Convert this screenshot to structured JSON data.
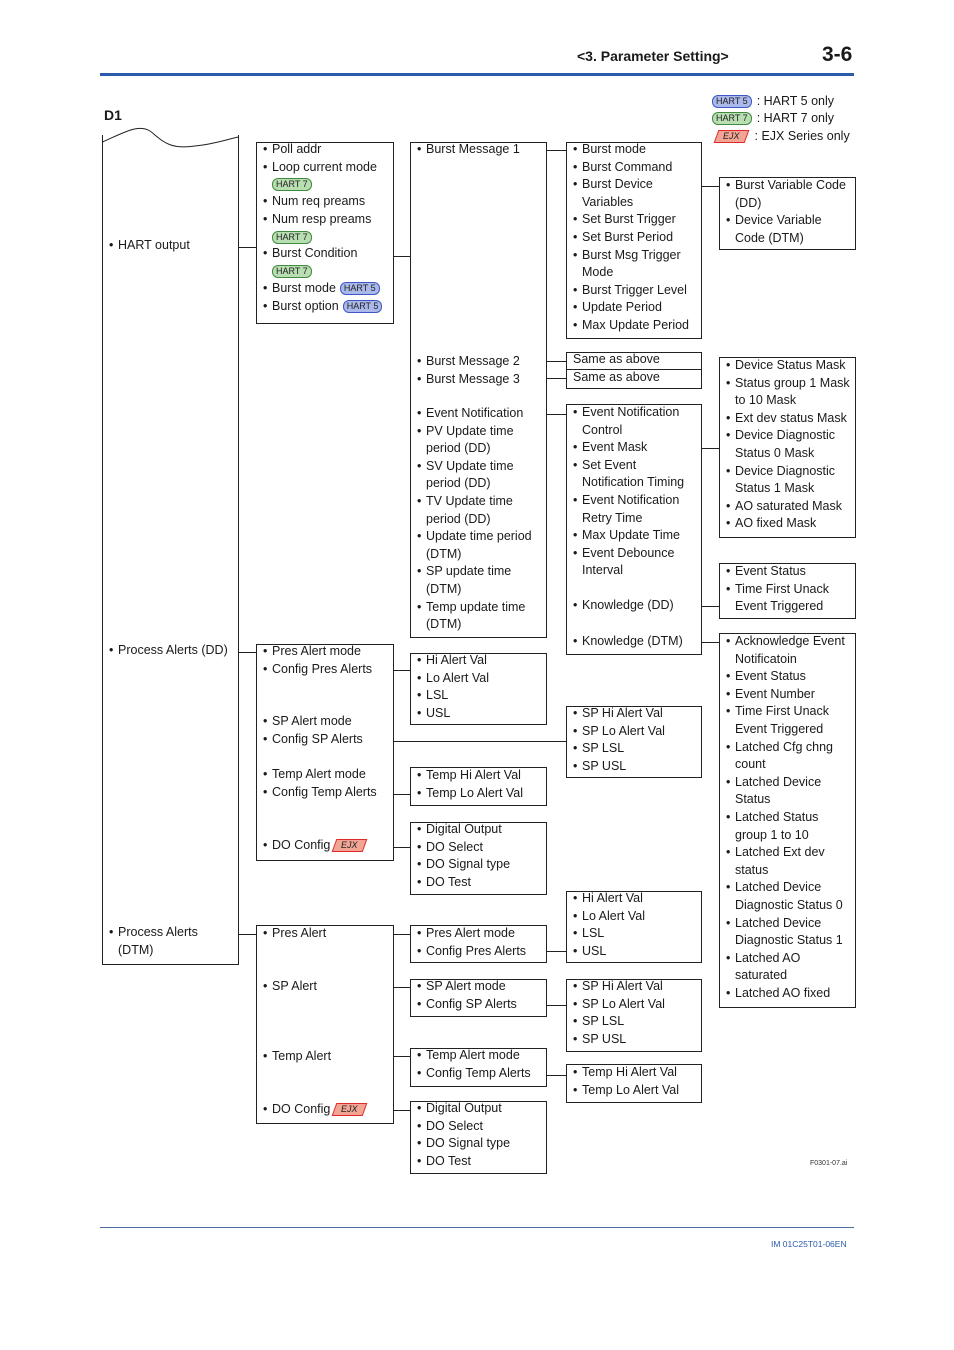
{
  "header": {
    "section": "<3.  Parameter Setting>",
    "page": "3-6"
  },
  "figure_label": "D1",
  "legend": [
    {
      "badge": "HART 5",
      "kind": "hart5",
      "label": ": HART 5 only"
    },
    {
      "badge": "HART 7",
      "kind": "hart7",
      "label": ": HART 7 only"
    },
    {
      "badge": "EJX",
      "kind": "ejx",
      "label": ": EJX Series only"
    }
  ],
  "colors": {
    "rule": "#2a5caa",
    "hart5": "#aab8ea",
    "hart7": "#b9deb2",
    "ejx": "#f2a595"
  },
  "boxes": [
    {
      "id": "root",
      "groups": [
        {
          "items": [
            {
              "text": "HART output"
            }
          ]
        },
        {
          "items": [
            {
              "text": "Process Alerts (DD)"
            }
          ]
        },
        {
          "items": [
            {
              "text": "Process Alerts\n(DTM)"
            }
          ]
        }
      ]
    },
    {
      "id": "hart-output",
      "groups": [
        {
          "items": [
            {
              "text": "Poll addr"
            },
            {
              "text": "Loop current mode",
              "badge": "HART 7",
              "kind": "hart7",
              "pos": "below"
            },
            {
              "text": "Num req preams"
            },
            {
              "text": "Num resp preams",
              "badge": "HART 7",
              "kind": "hart7",
              "pos": "below"
            },
            {
              "text": "Burst Condition",
              "badge": "HART 7",
              "kind": "hart7",
              "pos": "below"
            },
            {
              "text": "Burst mode",
              "badge": "HART 5",
              "kind": "hart5",
              "pos": "inline"
            },
            {
              "text": "Burst option",
              "badge": "HART 5",
              "kind": "hart5",
              "pos": "inline"
            }
          ]
        }
      ]
    },
    {
      "id": "burst-messages",
      "groups": [
        {
          "items": [
            {
              "text": "Burst Message 1"
            }
          ]
        },
        {
          "items": [
            {
              "text": "Burst Message 2"
            },
            {
              "text": "Burst Message 3"
            }
          ]
        },
        {
          "items": [
            {
              "text": "Event Notification"
            },
            {
              "text": "PV Update time\nperiod (DD)"
            },
            {
              "text": "SV Update time\nperiod (DD)"
            },
            {
              "text": "TV Update time\nperiod (DD)"
            },
            {
              "text": "Update time period\n(DTM)"
            },
            {
              "text": "SP update time\n(DTM)"
            },
            {
              "text": "Temp update time\n(DTM)"
            }
          ]
        }
      ]
    },
    {
      "id": "burst-message-1",
      "groups": [
        {
          "items": [
            {
              "text": "Burst mode"
            },
            {
              "text": "Burst Command"
            },
            {
              "text": "Burst Device\nVariables"
            },
            {
              "text": "Set Burst Trigger"
            },
            {
              "text": "Set Burst Period"
            },
            {
              "text": "Burst Msg Trigger\nMode"
            },
            {
              "text": "Burst Trigger Level"
            },
            {
              "text": "Update Period"
            },
            {
              "text": "Max Update Period"
            }
          ]
        }
      ]
    },
    {
      "id": "burst-variable",
      "groups": [
        {
          "items": [
            {
              "text": "Burst Variable Code\n (DD)"
            },
            {
              "text": "Device Variable\nCode (DTM)"
            }
          ]
        }
      ]
    },
    {
      "id": "burst-message-2",
      "groups": [
        {
          "items": [
            {
              "text": "Same as above",
              "nobullet": true
            }
          ]
        }
      ]
    },
    {
      "id": "burst-message-3",
      "groups": [
        {
          "items": [
            {
              "text": "Same as above",
              "nobullet": true
            }
          ]
        }
      ]
    },
    {
      "id": "event-notification",
      "groups": [
        {
          "items": [
            {
              "text": "Event Notification\nControl"
            },
            {
              "text": "Event Mask"
            },
            {
              "text": "Set Event\nNotification Timing"
            },
            {
              "text": "Event Notification\nRetry Time"
            },
            {
              "text": "Max Update Time"
            },
            {
              "text": "Event Debounce\nInterval"
            }
          ]
        },
        {
          "items": [
            {
              "text": "Knowledge (DD)"
            }
          ]
        },
        {
          "items": [
            {
              "text": "Knowledge (DTM)"
            }
          ]
        }
      ]
    },
    {
      "id": "event-mask",
      "groups": [
        {
          "items": [
            {
              "text": "Device Status Mask"
            },
            {
              "text": "Status group 1 Mask\nto 10 Mask"
            },
            {
              "text": "Ext dev status Mask"
            },
            {
              "text": "Device Diagnostic\nStatus 0 Mask"
            },
            {
              "text": "Device Diagnostic\nStatus 1 Mask"
            },
            {
              "text": "AO saturated Mask"
            },
            {
              "text": "AO fixed Mask"
            }
          ]
        }
      ]
    },
    {
      "id": "knowledge-dd",
      "groups": [
        {
          "items": [
            {
              "text": "Event Status"
            },
            {
              "text": "Time First Unack\nEvent Triggered"
            }
          ]
        }
      ]
    },
    {
      "id": "knowledge-dtm",
      "groups": [
        {
          "items": [
            {
              "text": "Acknowledge Event\nNotificatoin"
            },
            {
              "text": "Event Status"
            },
            {
              "text": "Event Number"
            },
            {
              "text": "Time First Unack\nEvent Triggered"
            },
            {
              "text": "Latched Cfg chng\ncount"
            },
            {
              "text": "Latched Device\nStatus"
            },
            {
              "text": "Latched Status\ngroup 1 to 10"
            },
            {
              "text": "Latched Ext dev\nstatus"
            },
            {
              "text": "Latched Device\nDiagnostic Status 0"
            },
            {
              "text": "Latched Device\nDiagnostic Status 1"
            },
            {
              "text": "Latched AO\nsaturated"
            },
            {
              "text": "Latched AO fixed"
            }
          ]
        }
      ]
    },
    {
      "id": "process-alerts-dd",
      "groups": [
        {
          "items": [
            {
              "text": "Pres Alert mode"
            },
            {
              "text": "Config Pres Alerts"
            }
          ]
        },
        {
          "items": [
            {
              "text": "SP Alert mode"
            },
            {
              "text": "Config SP Alerts"
            }
          ]
        },
        {
          "items": [
            {
              "text": "Temp Alert mode"
            },
            {
              "text": "Config Temp Alerts"
            }
          ]
        },
        {
          "items": [
            {
              "text": "DO Config",
              "badge": "EJX",
              "kind": "ejx",
              "pos": "inline"
            }
          ]
        }
      ]
    },
    {
      "id": "dd-pres-alerts",
      "groups": [
        {
          "items": [
            {
              "text": "Hi Alert Val"
            },
            {
              "text": "Lo Alert Val"
            },
            {
              "text": "LSL"
            },
            {
              "text": "USL"
            }
          ]
        }
      ]
    },
    {
      "id": "dd-sp-alerts",
      "groups": [
        {
          "items": [
            {
              "text": "SP Hi Alert Val"
            },
            {
              "text": "SP Lo Alert Val"
            },
            {
              "text": "SP LSL"
            },
            {
              "text": "SP USL"
            }
          ]
        }
      ]
    },
    {
      "id": "dd-temp-alerts",
      "groups": [
        {
          "items": [
            {
              "text": "Temp Hi Alert Val"
            },
            {
              "text": "Temp Lo Alert Val"
            }
          ]
        }
      ]
    },
    {
      "id": "dd-do-config",
      "groups": [
        {
          "items": [
            {
              "text": "Digital Output"
            },
            {
              "text": "DO Select"
            },
            {
              "text": "DO Signal type"
            },
            {
              "text": "DO Test"
            }
          ]
        }
      ]
    },
    {
      "id": "process-alerts-dtm",
      "groups": [
        {
          "items": [
            {
              "text": "Pres Alert"
            }
          ]
        },
        {
          "items": [
            {
              "text": "SP Alert"
            }
          ]
        },
        {
          "items": [
            {
              "text": "Temp Alert"
            }
          ]
        },
        {
          "items": [
            {
              "text": "DO Config",
              "badge": "EJX",
              "kind": "ejx",
              "pos": "inline"
            }
          ]
        }
      ]
    },
    {
      "id": "dtm-pres-alert",
      "groups": [
        {
          "items": [
            {
              "text": "Pres Alert mode"
            },
            {
              "text": "Config Pres Alerts"
            }
          ]
        }
      ]
    },
    {
      "id": "dtm-sp-alert",
      "groups": [
        {
          "items": [
            {
              "text": "SP Alert mode"
            },
            {
              "text": "Config SP Alerts"
            }
          ]
        }
      ]
    },
    {
      "id": "dtm-temp-alert",
      "groups": [
        {
          "items": [
            {
              "text": "Temp Alert mode"
            },
            {
              "text": "Config Temp Alerts"
            }
          ]
        }
      ]
    },
    {
      "id": "dtm-do-config",
      "groups": [
        {
          "items": [
            {
              "text": "Digital Output"
            },
            {
              "text": "DO Select"
            },
            {
              "text": "DO Signal type"
            },
            {
              "text": "DO Test"
            }
          ]
        }
      ]
    },
    {
      "id": "dtm-pres-values",
      "groups": [
        {
          "items": [
            {
              "text": "Hi Alert Val"
            },
            {
              "text": "Lo Alert Val"
            },
            {
              "text": "LSL"
            },
            {
              "text": "USL"
            }
          ]
        }
      ]
    },
    {
      "id": "dtm-sp-values",
      "groups": [
        {
          "items": [
            {
              "text": "SP Hi Alert Val"
            },
            {
              "text": "SP Lo Alert Val"
            },
            {
              "text": "SP LSL"
            },
            {
              "text": "SP USL"
            }
          ]
        }
      ]
    },
    {
      "id": "dtm-temp-values",
      "groups": [
        {
          "items": [
            {
              "text": "Temp Hi Alert Val"
            },
            {
              "text": "Temp Lo Alert Val"
            }
          ]
        }
      ]
    }
  ],
  "figure_id": "F0301-07.ai",
  "footer": {
    "doc_number": "IM 01C25T01-06EN"
  }
}
